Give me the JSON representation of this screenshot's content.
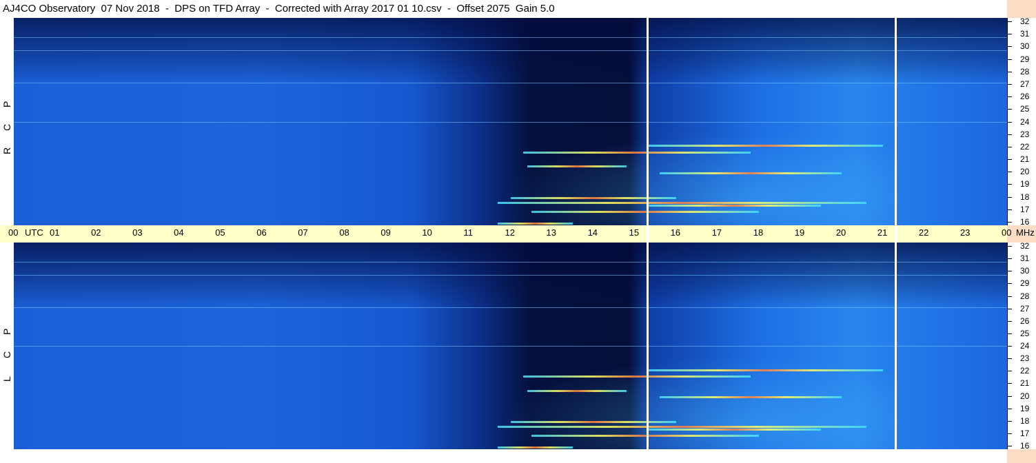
{
  "title": "AJ4CO Observatory  07 Nov 2018  -  DPS on TFD Array  -  Corrected with Array 2017 01 10.csv  -  Offset 2075  Gain 5.0",
  "chart_data": {
    "type": "heatmap",
    "title": "AJ4CO Observatory  07 Nov 2018  -  DPS on TFD Array  -  Corrected with Array 2017 01 10.csv  -  Offset 2075  Gain 5.0",
    "x_axis": {
      "unit": "UTC",
      "tick_labels": [
        "00",
        "01",
        "02",
        "03",
        "04",
        "05",
        "06",
        "07",
        "08",
        "09",
        "10",
        "11",
        "12",
        "13",
        "14",
        "15",
        "16",
        "17",
        "18",
        "19",
        "20",
        "21",
        "22",
        "23",
        "00"
      ],
      "xlim": [
        0,
        24
      ]
    },
    "y_axis": {
      "unit": "MHz",
      "tick_labels": [
        "32",
        "31",
        "30",
        "29",
        "28",
        "27",
        "26",
        "25",
        "24",
        "23",
        "22",
        "21",
        "20",
        "19",
        "18",
        "17",
        "16"
      ],
      "ylim": [
        16,
        32
      ]
    },
    "panels": [
      {
        "polarization": "RCP",
        "letters": [
          "R",
          "C",
          "P"
        ]
      },
      {
        "polarization": "LCP",
        "letters": [
          "L",
          "C",
          "P"
        ]
      }
    ],
    "gap_markers_utc": [
      15.3,
      21.3
    ],
    "colors": {
      "background_blue": "#1c64dc",
      "dark": "#050f3a",
      "axis_band": "#ffffc8",
      "right_strip": "#fcdcc4"
    }
  }
}
